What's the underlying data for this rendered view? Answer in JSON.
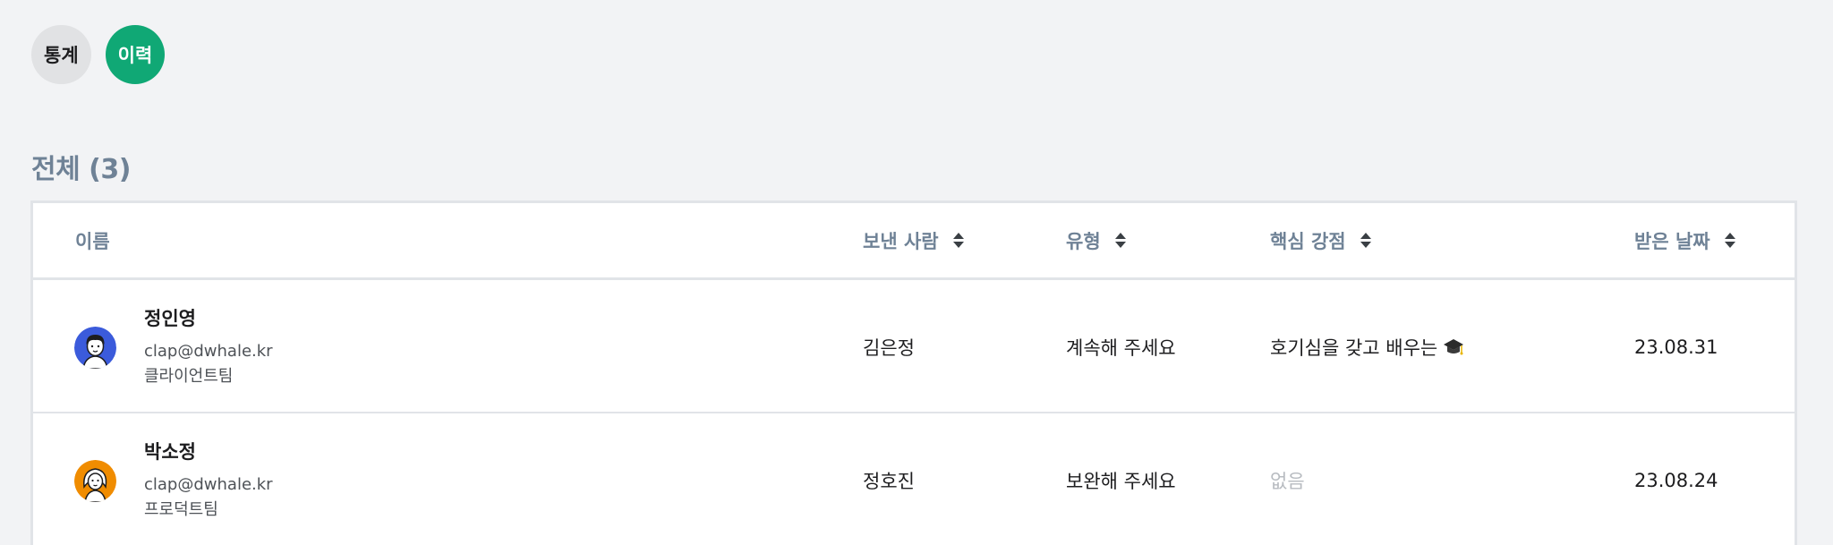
{
  "tabs": [
    {
      "label": "통계",
      "active": false
    },
    {
      "label": "이력",
      "active": true
    }
  ],
  "section": {
    "title": "전체 (3)"
  },
  "table": {
    "headers": {
      "name": "이름",
      "sender": "보낸 사람",
      "type": "유형",
      "strength": "핵심 강점",
      "date": "받은 날짜"
    },
    "rows": [
      {
        "name": "정인영",
        "email": "clap@dwhale.kr",
        "team": "클라이언트팀",
        "avatar_color": "#3b5bdb",
        "sender": "김은정",
        "type": "계속해 주세요",
        "strength": "호기심을 갖고 배우는",
        "strength_icon": "graduation-cap-icon",
        "date": "23.08.31"
      },
      {
        "name": "박소정",
        "email": "clap@dwhale.kr",
        "team": "프로덕트팀",
        "avatar_color": "#f08c00",
        "sender": "정호진",
        "type": "보완해 주세요",
        "strength": "없음",
        "date": "23.08.24"
      }
    ]
  },
  "colors": {
    "accent": "#10a875",
    "header_text": "#6f8296",
    "background": "#f2f3f5"
  }
}
